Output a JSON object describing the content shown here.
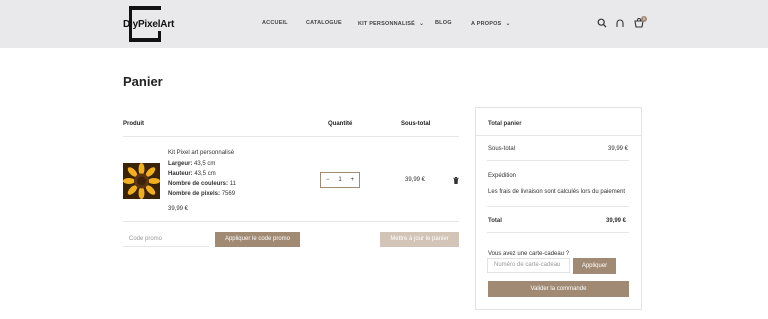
{
  "header": {
    "logo_text": "DiyPixelArt",
    "nav": [
      {
        "label": "ACCUEIL",
        "has_dropdown": false
      },
      {
        "label": "CATALOGUE",
        "has_dropdown": false
      },
      {
        "label": "KIT PERSONNALISÉ",
        "has_dropdown": true
      },
      {
        "label": "BLOG",
        "has_dropdown": false
      },
      {
        "label": "A PROPOS",
        "has_dropdown": true
      }
    ],
    "cart_count": "0"
  },
  "page_title": "Panier",
  "cart_table": {
    "col_product": "Produit",
    "col_quantity": "Quantité",
    "col_subtotal": "Sous-total",
    "item": {
      "name": "Kit Pixel art personnalisé",
      "attributes": [
        {
          "label": "Largeur:",
          "value": "43,5 cm"
        },
        {
          "label": "Hauteur:",
          "value": "43,5 cm"
        },
        {
          "label": "Nombre de couleurs:",
          "value": "11"
        },
        {
          "label": "Nombre de pixels:",
          "value": "7569"
        }
      ],
      "price": "39,99 €",
      "quantity": "1",
      "minus": "−",
      "plus": "+",
      "subtotal": "39,99 €"
    }
  },
  "promo": {
    "placeholder": "Code promo",
    "apply_label": "Appliquer le code promo",
    "update_label": "Mettre à jour le panier"
  },
  "totals": {
    "title": "Total panier",
    "subtotal_label": "Sous-total",
    "subtotal_value": "39,99 €",
    "shipping_label": "Expédition",
    "shipping_note": "Les frais de livraison sont calculés lors du paiement",
    "total_label": "Total",
    "total_value": "39,99 €",
    "gift_question": "Vous avez une carte-cadeau ?",
    "gift_placeholder": "Numéro de carte-cadeau",
    "gift_apply": "Appliquer",
    "checkout_label": "Valider la commande"
  },
  "colors": {
    "header_bg": "#e9e9eb",
    "accent": "#a08a73",
    "accent_disabled": "#d2c4b7"
  }
}
